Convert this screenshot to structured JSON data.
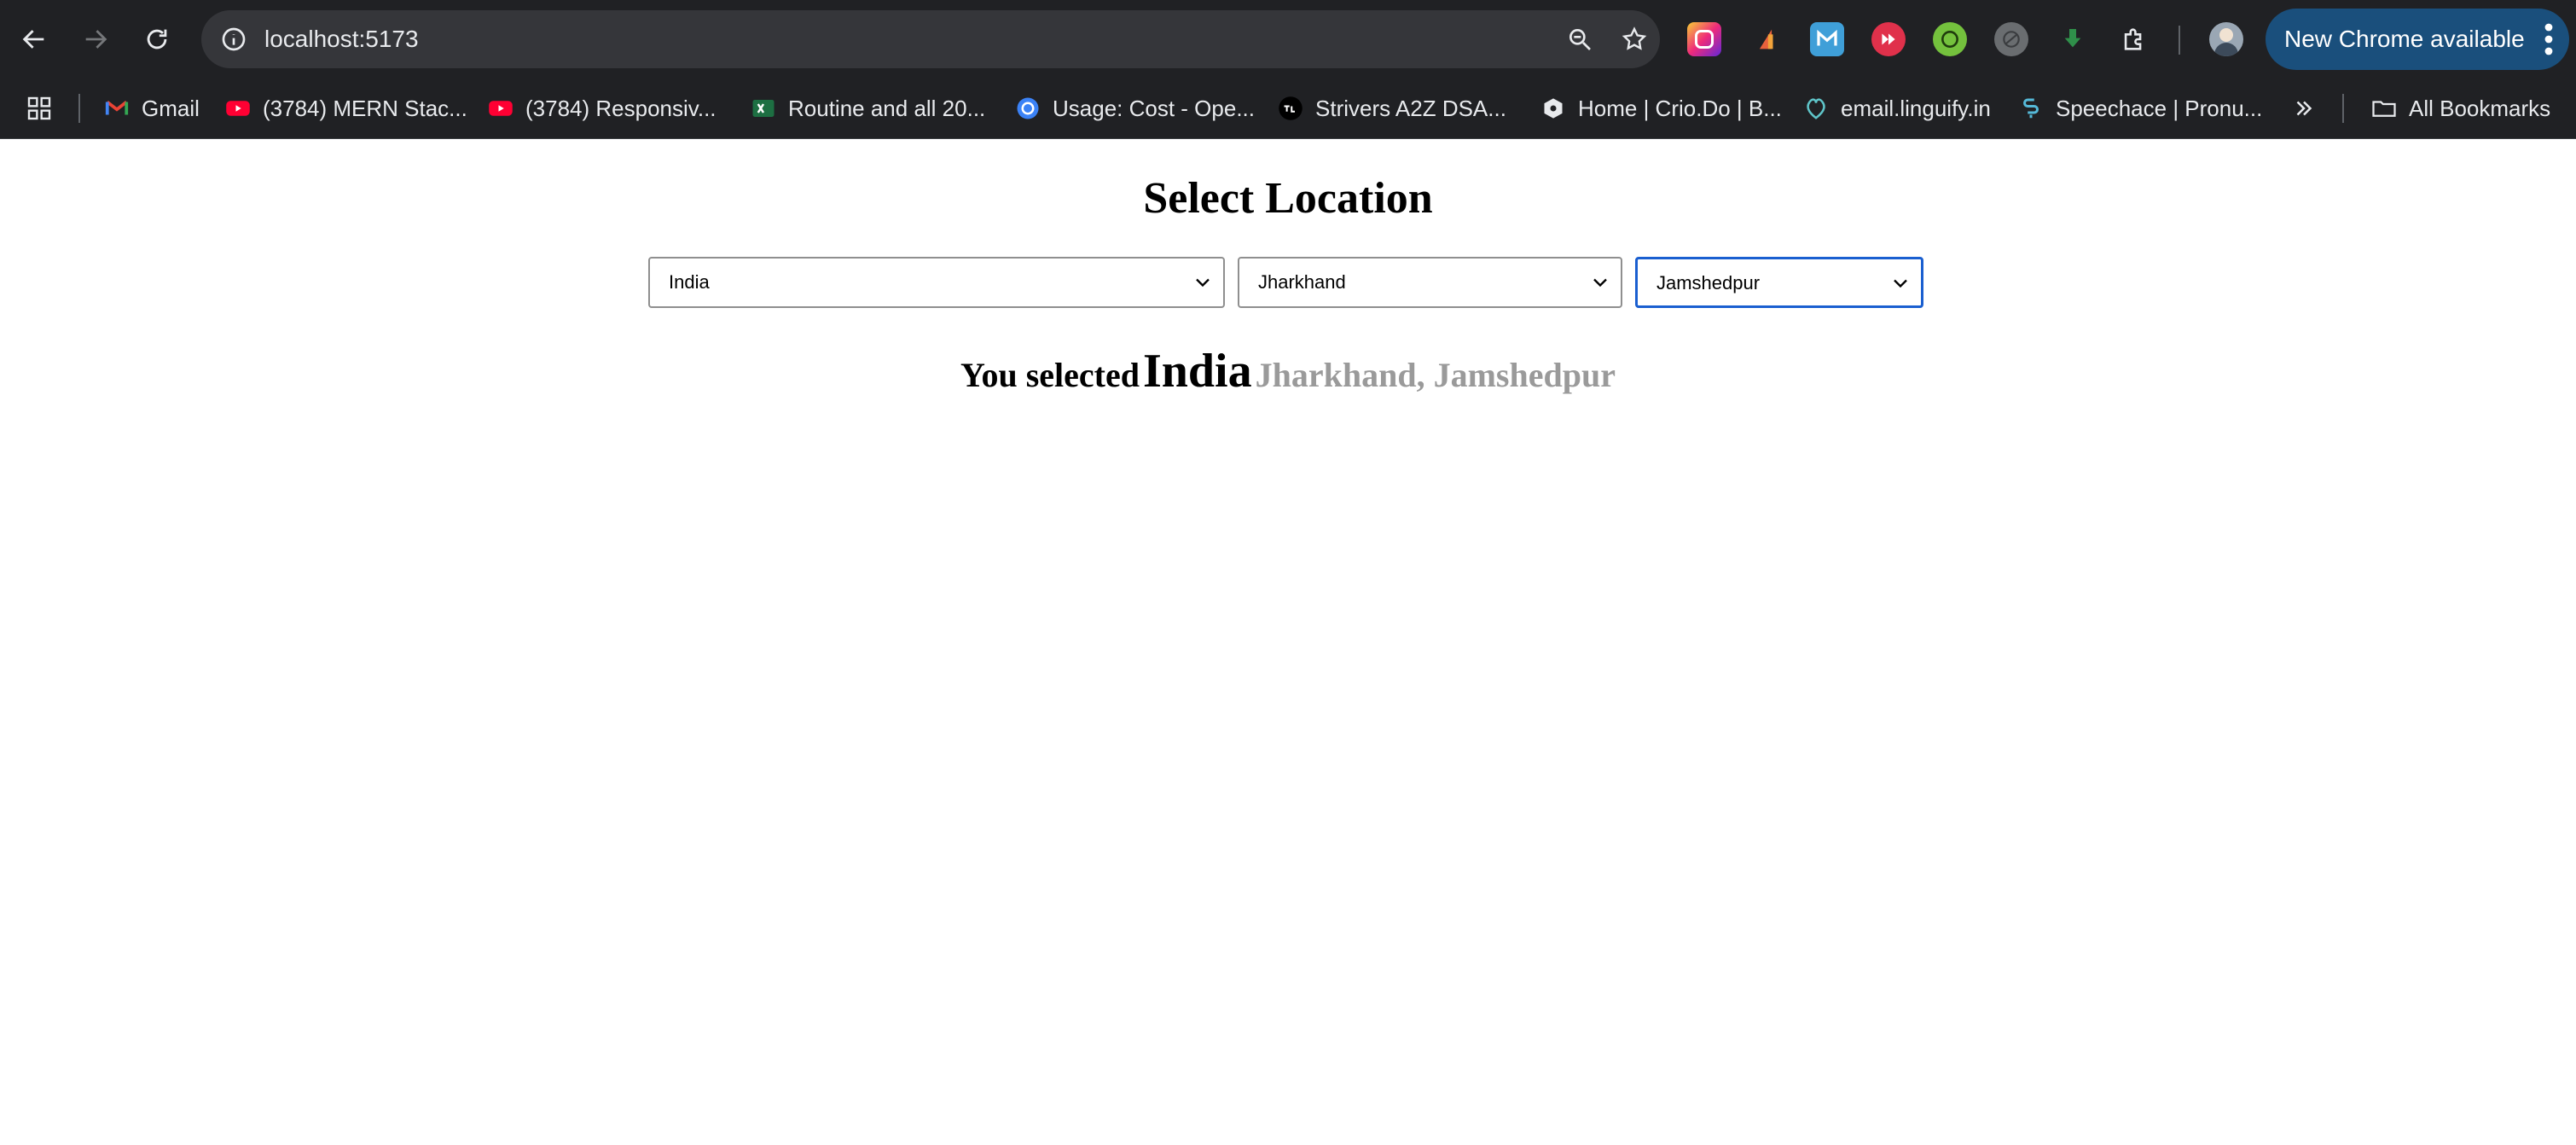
{
  "browser": {
    "url": "localhost:5173",
    "update_button": "New Chrome available",
    "bookmarks": [
      {
        "icon": "gmail-icon",
        "label": "Gmail"
      },
      {
        "icon": "youtube-icon",
        "label": "(3784) MERN Stac..."
      },
      {
        "icon": "youtube-icon",
        "label": "(3784) Responsiv..."
      },
      {
        "icon": "excel-icon",
        "label": "Routine and all 20..."
      },
      {
        "icon": "openai-icon",
        "label": "Usage: Cost - Ope..."
      },
      {
        "icon": "tuf-icon",
        "label": "Strivers A2Z DSA..."
      },
      {
        "icon": "crio-icon",
        "label": "Home | Crio.Do | B..."
      },
      {
        "icon": "linguify-icon",
        "label": "email.linguify.in"
      },
      {
        "icon": "speechace-icon",
        "label": "Speechace | Pronu..."
      }
    ],
    "all_bookmarks": "All Bookmarks",
    "colors": {
      "chrome": "#202124",
      "omnibox": "#35363a",
      "update_button": "#1a4f7c"
    }
  },
  "page": {
    "title": "Select Location",
    "selects": {
      "country": "India",
      "state": "Jharkhand",
      "city": "Jamshedpur"
    },
    "summary": {
      "prefix": "You selected",
      "country": "India",
      "rest": "Jharkhand, Jamshedpur"
    },
    "colors": {
      "focus": "#1a5fd0",
      "muted_text": "#9a9a9a"
    }
  }
}
